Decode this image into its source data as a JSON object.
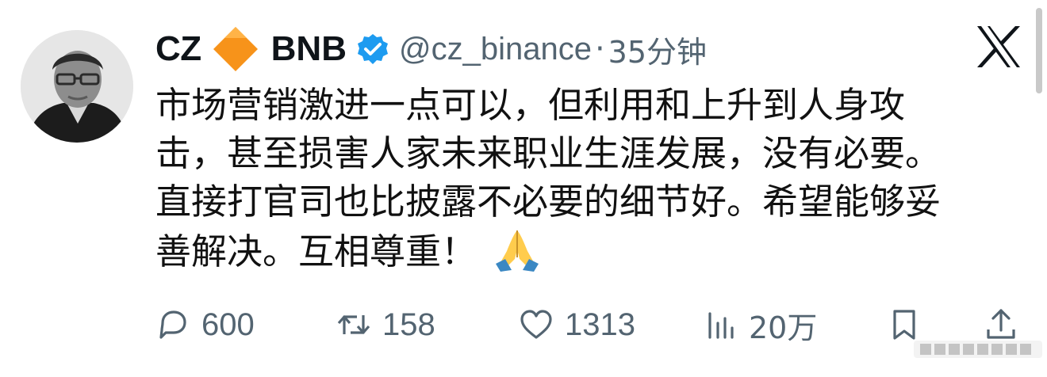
{
  "author": {
    "display_name": "CZ",
    "badge_emoji": "orange-diamond",
    "tag_name": "BNB",
    "handle": "@cz_binance",
    "separator": "·",
    "time_ago": "35分钟"
  },
  "tweet": {
    "lines": [
      "市场营销激进一点可以，但利用和上升到人身攻",
      "击，甚至损害人家未来职业生涯发展，没有必要。",
      "直接打官司也比披露不必要的细节好。希望能够妥",
      "善解决。互相尊重！"
    ],
    "emoji": "folded-hands"
  },
  "actions": {
    "replies": "600",
    "reposts": "158",
    "likes": "1313",
    "views": "20万"
  },
  "colors": {
    "text": "#0f1419",
    "secondary": "#536471",
    "verified": "#1d9bf0",
    "bnb_orange": "#f7931a"
  }
}
